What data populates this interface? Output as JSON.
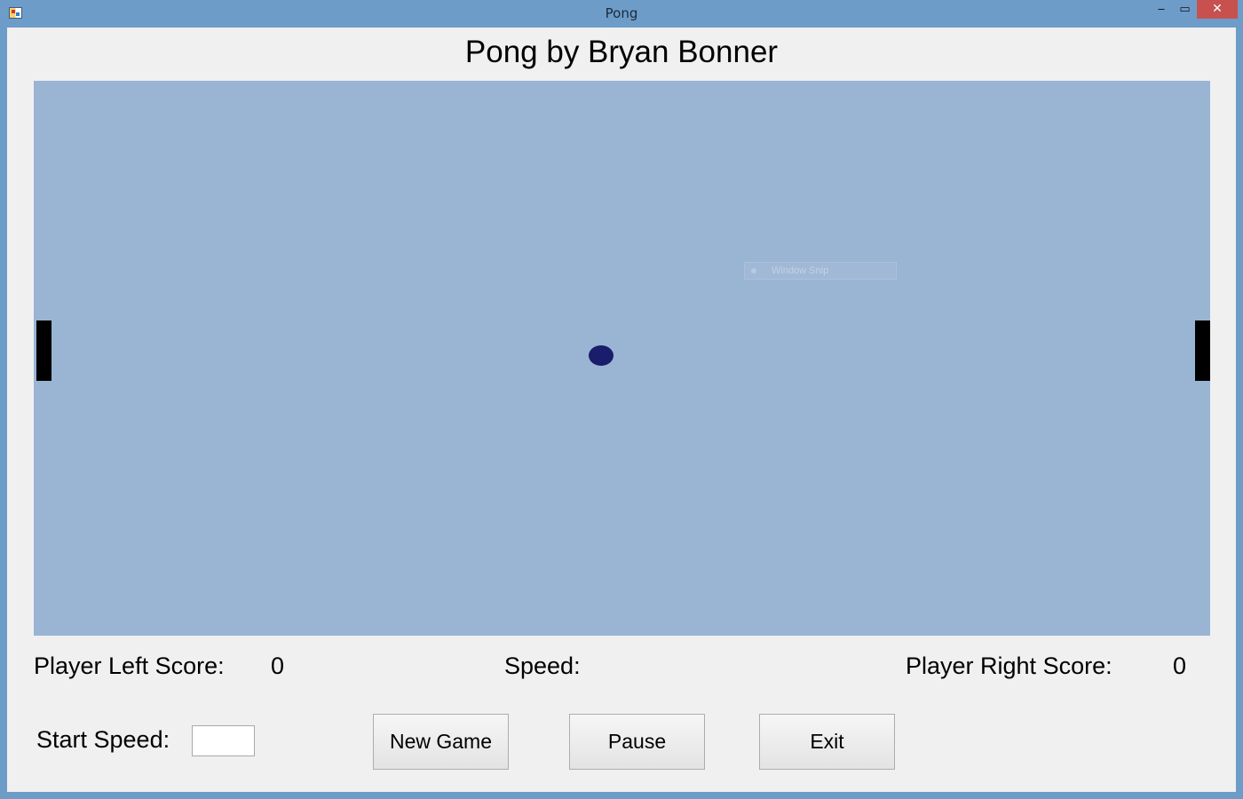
{
  "window": {
    "title": "Pong",
    "controls": {
      "minimize": "‒",
      "maximize": "▭",
      "close": "✕"
    }
  },
  "heading": "Pong by Bryan Bonner",
  "scoreboard": {
    "left_label": "Player Left Score:",
    "left_value": "0",
    "speed_label": "Speed:",
    "right_label": "Player Right Score:",
    "right_value": "0"
  },
  "controls": {
    "start_speed_label": "Start Speed:",
    "start_speed_value": "",
    "new_game_label": "New Game",
    "pause_label": "Pause",
    "exit_label": "Exit"
  },
  "overlay": {
    "window_snip_text": "Window Snip"
  },
  "colors": {
    "titlebar": "#6d9cc9",
    "client_background": "#f0f0f0",
    "court": "#9ab4d3",
    "ball": "#1a1d6b",
    "paddle": "#000000",
    "close_button": "#c7514f"
  }
}
